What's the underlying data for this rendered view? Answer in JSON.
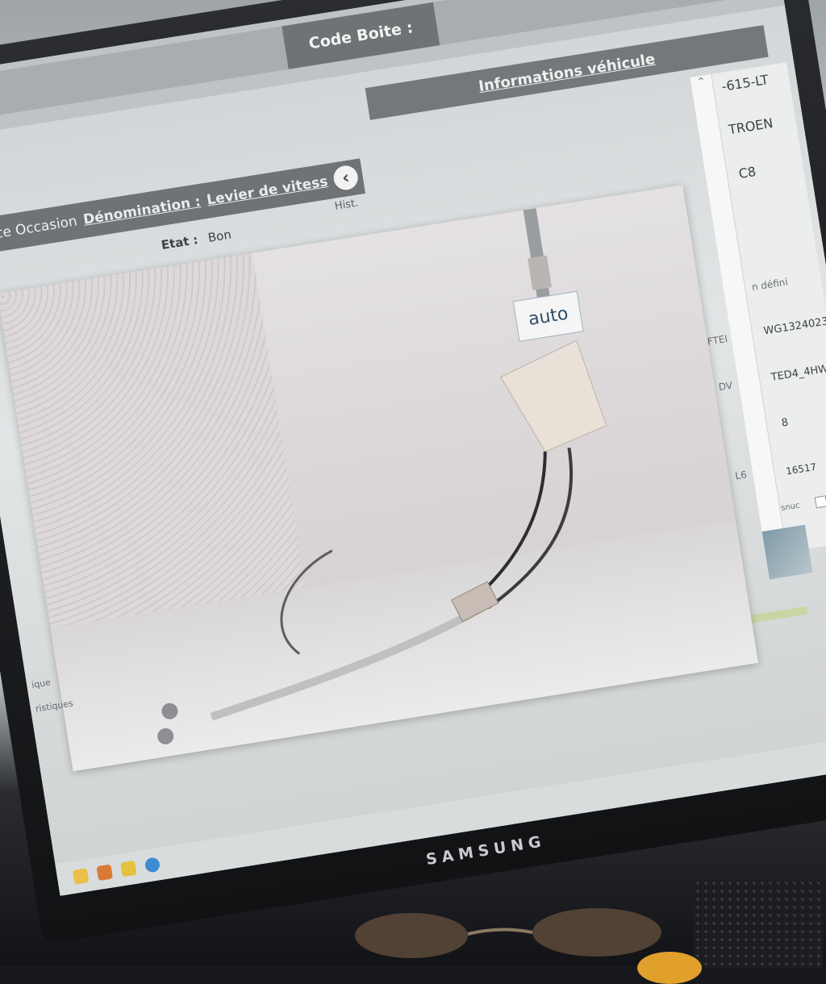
{
  "header": {
    "code_boite_label": "Code Boite :",
    "close_glyph": "×"
  },
  "piece": {
    "occasion_label": "Piece Occasion",
    "denomination_label": "Dénomination :",
    "denomination_value": "Levier de vitess",
    "back_glyph": "‹",
    "hist_label": "Hist.",
    "etat_label": "Etat :",
    "etat_value": "Bon"
  },
  "vehicle": {
    "title": "Informations véhicule",
    "plate": "-615-LT",
    "make": "TROEN",
    "model": "C8",
    "status": "n défini",
    "code1_label": "FTEI",
    "code1_value": "WG1324023",
    "engine_label": "DV",
    "engine_value": "TED4_4HW",
    "value_8": "8",
    "l6_label": "L6",
    "number_value": "16517",
    "checkbox_label": "aisnuc"
  },
  "photo": {
    "tag_text": "auto"
  },
  "side": {
    "label1": "ique",
    "label2": "ristiques"
  },
  "monitor": {
    "brand": "SAMSUNG"
  },
  "colors": {
    "header_bar": "#6f7375",
    "panel_bg": "#eceeee",
    "progress": "#c9d5a2"
  }
}
